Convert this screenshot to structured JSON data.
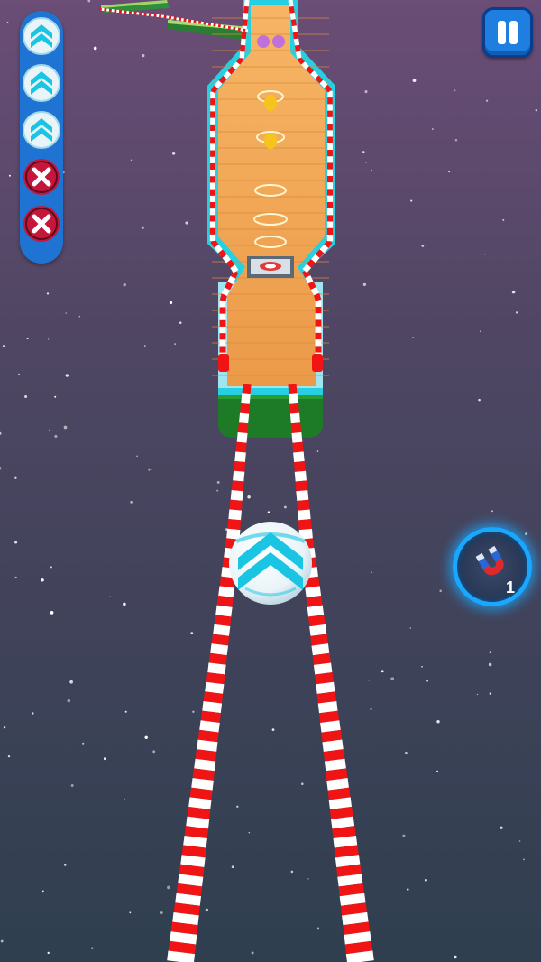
{
  "hud": {
    "lives": [
      {
        "state": "active",
        "icon": "chevron-up-icon"
      },
      {
        "state": "active",
        "icon": "chevron-up-icon"
      },
      {
        "state": "active",
        "icon": "chevron-up-icon"
      },
      {
        "state": "lost",
        "icon": "close-icon"
      },
      {
        "state": "lost",
        "icon": "close-icon"
      }
    ],
    "pause": {
      "icon": "pause-icon"
    },
    "powerup": {
      "icon": "magnet-icon",
      "count": "1"
    }
  },
  "colors": {
    "sky_top": "#6b4d76",
    "sky_bottom": "#2f3f4f",
    "rail_red": "#f01414",
    "rail_white": "#ffffff",
    "wood": "#f0a24f",
    "track_edge": "#27d0e0",
    "ball_cyan": "#19c5e3",
    "hud_blue": "#1f74d3",
    "life_lost": "#c4173b"
  }
}
